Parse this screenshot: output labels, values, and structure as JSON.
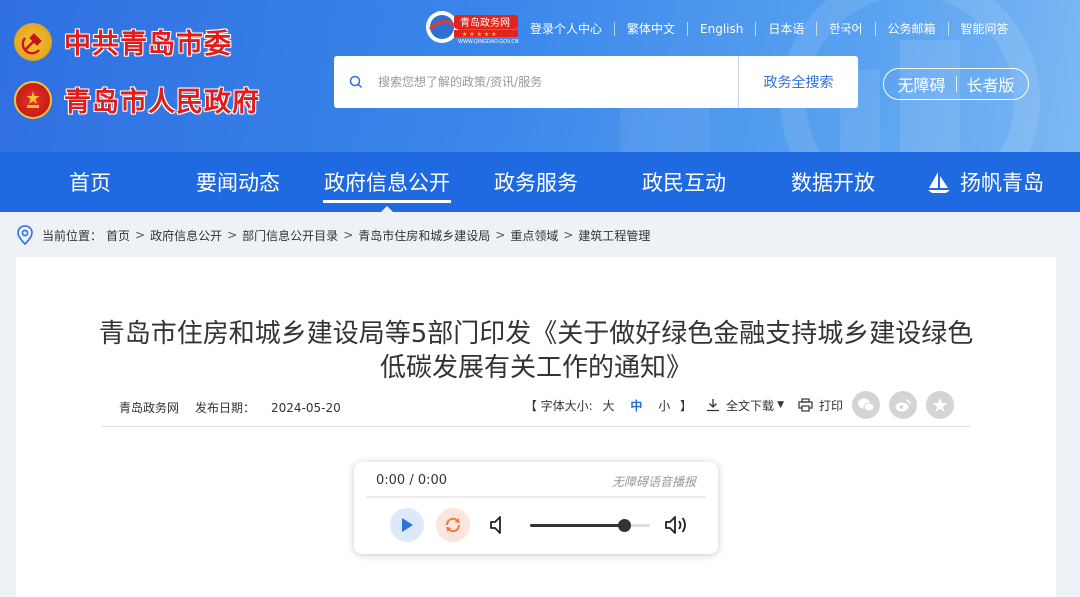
{
  "header": {
    "party_title": "中共青岛市委",
    "gov_title": "青岛市人民政府",
    "site_badge": {
      "text": "青岛政务网",
      "domain": "WWW.QINGDAO.GOV.CN"
    },
    "top_links": [
      "登录个人中心",
      "繁体中文",
      "English",
      "日本语",
      "한국어",
      "公务邮箱",
      "智能问答"
    ],
    "search": {
      "placeholder": "搜索您想了解的政策/资讯/服务",
      "button": "政务全搜索"
    },
    "accessibility": {
      "barrier_free": "无障碍",
      "elder_mode": "长者版"
    }
  },
  "nav": {
    "items": [
      "首页",
      "要闻动态",
      "政府信息公开",
      "政务服务",
      "政民互动",
      "数据开放",
      "扬帆青岛"
    ],
    "active_index": 2
  },
  "breadcrumb": {
    "label": "当前位置：",
    "items": [
      "首页",
      "政府信息公开",
      "部门信息公开目录",
      "青岛市住房和城乡建设局",
      "重点领域",
      "建筑工程管理"
    ],
    "separator": ">"
  },
  "article": {
    "title": "青岛市住房和城乡建设局等5部门印发《关于做好绿色金融支持城乡建设绿色低碳发展有关工作的通知》",
    "source": "青岛政务网",
    "date_label": "发布日期：",
    "date": "2024-05-20",
    "font_size_label": "【 字体大小:",
    "font_sizes": [
      "大",
      "中",
      "小"
    ],
    "font_size_close": "】",
    "download_label": "全文下载",
    "print_label": "打印",
    "share_icons": [
      "wechat-icon",
      "weibo-icon",
      "favorite-icon"
    ]
  },
  "player": {
    "time": "0:00 / 0:00",
    "label": "无障碍语音播报",
    "volume": 0.78
  },
  "colors": {
    "header_blue": "#2f6fe0",
    "nav_blue": "#1f6ae0",
    "logo_red": "#e21b1b",
    "accent_blue": "#1f6ae0"
  }
}
